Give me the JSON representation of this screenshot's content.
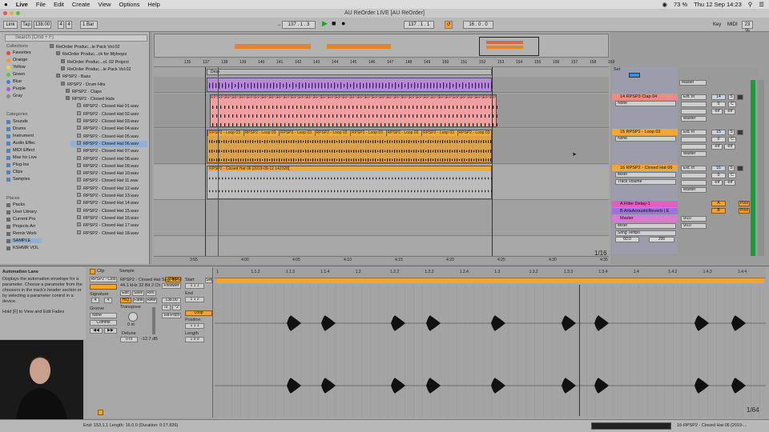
{
  "menubar": {
    "apple_icon": "apple-icon",
    "items": [
      "Live",
      "File",
      "Edit",
      "Create",
      "View",
      "Options",
      "Help"
    ],
    "battery": "73 %",
    "clock": "Thu 12 Sep  14:23"
  },
  "window": {
    "title": "AU ReOrder LIVE  [AU ReOrder]"
  },
  "transport": {
    "link": "Link",
    "tap": "Tap",
    "tempo": "138.00",
    "sig_num": "4",
    "sig_den": "4",
    "quantize": "1 Bar",
    "position": "137 .  1 .  3",
    "loop_start": "137 .  1 .  1",
    "loop_length": "16 .  0 .  0",
    "key": "Key",
    "midi": "MIDI",
    "cpu": "23 %"
  },
  "browser": {
    "search_placeholder": "Search (Cmd + F)",
    "collections_title": "Collections",
    "collections": [
      {
        "label": "Favorites",
        "color": "#e14a3a"
      },
      {
        "label": "Orange",
        "color": "#f29a2a"
      },
      {
        "label": "Yellow",
        "color": "#ecd43a"
      },
      {
        "label": "Green",
        "color": "#5ec24a"
      },
      {
        "label": "Blue",
        "color": "#3a7fe0"
      },
      {
        "label": "Purple",
        "color": "#a25ad0"
      },
      {
        "label": "Gray",
        "color": "#8a8a8a"
      }
    ],
    "categories_title": "Categories",
    "categories": [
      "Sounds",
      "Drums",
      "Instrument",
      "Audio Effec",
      "MIDI Effect",
      "Max for Live",
      "Plug-Ins",
      "Clips",
      "Samples"
    ],
    "places_title": "Places",
    "places": [
      "Packs",
      "User Library",
      "Current Pro",
      "Projects Arr",
      "Remix Work",
      "SAMPLE",
      "KSHMR VOL"
    ],
    "files": [
      "ReOrder Produc...le Pack Vol.02",
      "ReOrder Produc...ck for Myloops",
      "ReOrder Produc...ol. 02 Project",
      "ReOrder Produc...le Pack Vol.02",
      "RPSP2 - Bass",
      "RPSP2 - Drum Hits",
      "RPSP2 - Claps",
      "RPSP2 - Closed Hats",
      "RPSP2 - Closed Hat 01.wav",
      "RPSP2 - Closed Hat 02.wav",
      "RPSP2 - Closed Hat 03.wav",
      "RPSP2 - Closed Hat 04.wav",
      "RPSP2 - Closed Hat 05.wav",
      "RPSP2 - Closed Hat 06.wav",
      "RPSP2 - Closed Hat 07.wav",
      "RPSP2 - Closed Hat 08.wav",
      "RPSP2 - Closed Hat 09.wav",
      "RPSP2 - Closed Hat 10.wav",
      "RPSP2 - Closed Hat 11.wav",
      "RPSP2 - Closed Hat 12.wav",
      "RPSP2 - Closed Hat 13.wav",
      "RPSP2 - Closed Hat 14.wav",
      "RPSP2 - Closed Hat 15.wav",
      "RPSP2 - Closed Hat 16.wav",
      "RPSP2 - Closed Hat 17.wav",
      "RPSP2 - Closed Hat 18.wav"
    ]
  },
  "arrangement": {
    "ruler_labels": [
      "135",
      "137",
      "138",
      "139",
      "140",
      "141",
      "142",
      "143",
      "144",
      "145",
      "146",
      "147",
      "148",
      "149",
      "150",
      "151",
      "152",
      "153",
      "154",
      "155",
      "156",
      "157",
      "158",
      "159"
    ],
    "locator": "Drop",
    "time_labels": [
      "3:55",
      "4:00",
      "4:05",
      "4:10",
      "4:15",
      "4:20",
      "4:25",
      "4:30",
      "4:35"
    ],
    "zoom": "1/16",
    "clip_label_clap": "RPS",
    "clip_label_loop": "RPSP2 - Loop 03",
    "clip_label_hat": "RPSP2 - Closed Hat 06 [2019-09-12 142328]"
  },
  "tracks": [
    {
      "name": "14 RPSP3 Clap 04",
      "color": "#f08a8a",
      "input": "Ext. In",
      "monitor": "None",
      "out": "Master",
      "vol": "14",
      "s": "S",
      "num1": "0",
      "num2": "C",
      "inf1": "-inf",
      "inf2": "-inf"
    },
    {
      "name": "15 RPSP2 - Loop 03",
      "color": "#f0a83a",
      "input": "Ext. In",
      "monitor": "None",
      "out": "Master",
      "vol": "15",
      "s": "S",
      "num1": "0",
      "num2": "C",
      "inf1": "-inf",
      "inf2": "-inf"
    },
    {
      "name": "16 RPSP2 - Closed Hat 06",
      "color": "#f0a83a",
      "input": "Ext. In",
      "monitor": "Mixer",
      "auto": "Track Volume",
      "out": "Master",
      "vol": "16",
      "s": "S",
      "num1": "0",
      "num2": "C",
      "inf1": "-inf",
      "inf2": "-inf"
    }
  ],
  "returns": [
    {
      "name": "A Filter Delay-1",
      "color": "#e060c0",
      "letter": "A",
      "post": "Post"
    },
    {
      "name": "B ArtsAcousticReverb | E",
      "color": "#a070e0",
      "letter": "B",
      "post": "Post"
    }
  ],
  "master": {
    "name": "Master",
    "color": "#d77ad0",
    "dd1": "Mixer",
    "dd2": "Song Tempo",
    "val1": "60.0",
    "val2": "200",
    "route1": "9/10",
    "route2": "9/10",
    "label_out": "Master",
    "set": "Set"
  },
  "info_view": {
    "title": "Automation Lane",
    "body": "Displays the automation envelope for a parameter. Choose a parameter from the choosers in the track's header section or by selecting a parameter control in a device.",
    "hint": "Hold [F] to View and Edit Fades"
  },
  "clip_view": {
    "clip_tab": "Clip",
    "sample_tab": "Sample",
    "clip_name": "RPSP2 - Clos",
    "sample_name": "RPSP2 - Closed Hat",
    "sample_info": "44.1 kHz 32 Bit 2 Ch",
    "warp": "Warp",
    "follower": "Follower",
    "signature": "Signature",
    "sig_num": "4",
    "sig_den": "4",
    "edit": "Edit",
    "save": "Save",
    "rev": "Rev.",
    "hiq": "HiQ",
    "fade": "Fade",
    "ram": "RAM",
    "groove": "Groove",
    "groove_val": "None",
    "commit": "Commit",
    "transpose": "Transpose",
    "transpose_val": "0 st",
    "detune": "Detune",
    "detune_val": "0 ct",
    "gain": "-12.7 dB",
    "start": "Start",
    "end": "End",
    "seg_bpm": "Seg. BPM",
    "bpm": "138.00",
    "half": "/2",
    "double": "*2",
    "repitch": "Re-Pitch",
    "loop": "Loop",
    "position": "Position",
    "length": "Length",
    "start_val": "1  1  1",
    "end_val": "1  1  2",
    "position_val": "1  1  1",
    "length_val": "1  0  0",
    "set": "Set"
  },
  "sample_view": {
    "ruler": [
      "1",
      "1.1.2",
      "1.1.3",
      "1.1.4",
      "1.2",
      "1.2.2",
      "1.2.3",
      "1.2.4",
      "1.3",
      "1.3.2",
      "1.3.3",
      "1.3.4",
      "1.4",
      "1.4.2",
      "1.4.3",
      "1.4.4"
    ],
    "zoom": "1/64"
  },
  "status": {
    "left": "End: 153.1.1     Length: 16.0.0   (Duration: 0:27.826)",
    "right": "16-RPSP2 - Closed Hat 06 [2019-..."
  }
}
